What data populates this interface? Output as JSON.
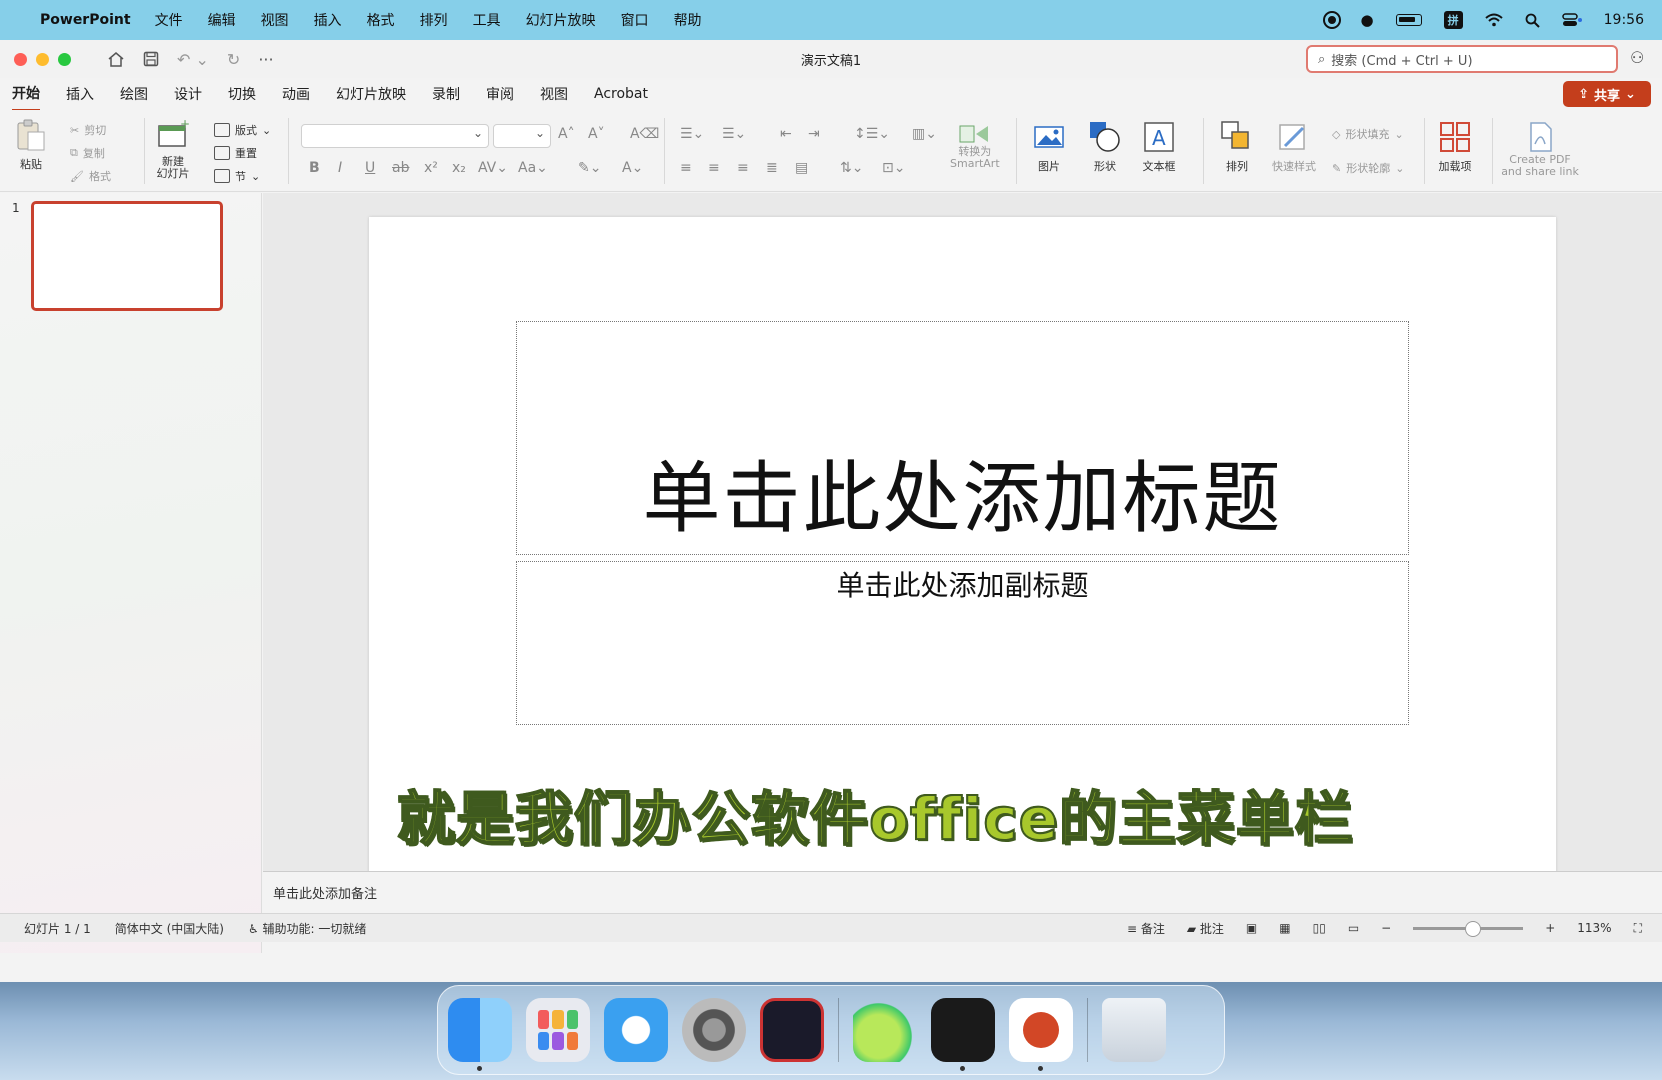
{
  "menubar": {
    "app_name": "PowerPoint",
    "items": [
      "文件",
      "编辑",
      "视图",
      "插入",
      "格式",
      "排列",
      "工具",
      "幻灯片放映",
      "窗口",
      "帮助"
    ],
    "ime": "拼",
    "time": "19:56"
  },
  "window": {
    "title": "演示文稿1",
    "search_placeholder": "搜索 (Cmd + Ctrl + U)"
  },
  "tabs": [
    "开始",
    "插入",
    "绘图",
    "设计",
    "切换",
    "动画",
    "幻灯片放映",
    "录制",
    "审阅",
    "视图",
    "Acrobat"
  ],
  "active_tab": "开始",
  "share_label": "共享",
  "ribbon": {
    "paste": "粘贴",
    "cut": "剪切",
    "copy": "复制",
    "format": "格式",
    "new_slide_1": "新建",
    "new_slide_2": "幻灯片",
    "layout": "版式",
    "reset": "重置",
    "section": "节",
    "convert_1": "转换为",
    "convert_2": "SmartArt",
    "picture": "图片",
    "shape": "形状",
    "textbox": "文本框",
    "arrange": "排列",
    "quick_styles": "快速样式",
    "shape_fill": "形状填充",
    "shape_outline": "形状轮廓",
    "addins": "加载项",
    "create_pdf_1": "Create PDF",
    "create_pdf_2": "and share link"
  },
  "thumbs": {
    "slide_number": "1"
  },
  "slide": {
    "title_placeholder": "单击此处添加标题",
    "subtitle_placeholder": "单击此处添加副标题",
    "caption": "就是我们办公软件office的主菜单栏"
  },
  "notes_placeholder": "单击此处添加备注",
  "statusbar": {
    "slide_count": "幻灯片 1 / 1",
    "language": "简体中文 (中国大陆)",
    "accessibility": "辅助功能: 一切就绪",
    "notes": "备注",
    "comments": "批注",
    "zoom": "113%"
  },
  "colors": {
    "accent": "#c43e1c",
    "caption_fill": "#a8c82c"
  }
}
